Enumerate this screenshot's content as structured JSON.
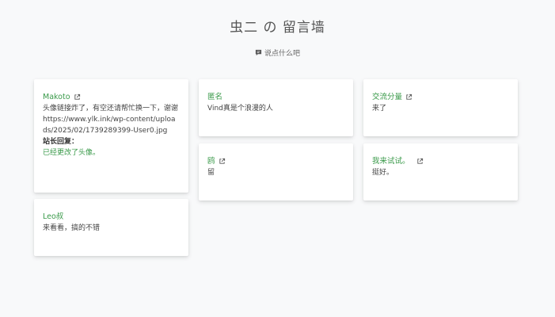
{
  "header": {
    "title": "虫二 の 留言墙",
    "say_label": "说点什么吧"
  },
  "cards": [
    {
      "name": "Makoto",
      "content": "头像链接炸了，有空还请帮忙换一下，谢谢https://www.ylk.ink/wp-content/uploads/2025/02/1739289399-User0.jpg",
      "reply_label": "站长回复：",
      "reply": "已经更改了头像。"
    },
    {
      "name": "匿名",
      "content": "Vind真是个浪漫的人"
    },
    {
      "name": "交流分量",
      "content": "来了"
    },
    {
      "name": "Leo叔",
      "content": "来看看，搞的不错"
    },
    {
      "name": "鸥",
      "content": "留"
    },
    {
      "name": "我来试试。",
      "content": "挺好。"
    }
  ],
  "colors": {
    "accent": "#3a9a4a",
    "background": "#f8f9fa"
  }
}
